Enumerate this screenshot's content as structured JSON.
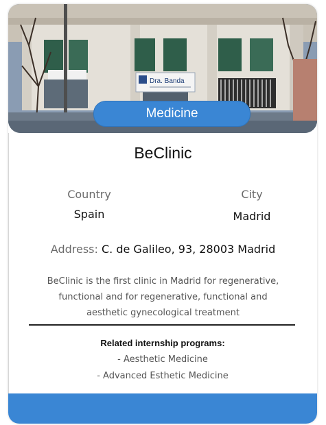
{
  "card": {
    "category": "Medicine",
    "name": "BeClinic",
    "country_label": "Country",
    "country_value": "Spain",
    "city_label": "City",
    "city_value": "Madrid",
    "address_label": "Address:",
    "address_value": "C. de Galileo, 93, 28003 Madrid",
    "description": "BeClinic is the first clinic in Madrid for regenerative, functional and for regenerative, functional and aesthetic gynecological treatment",
    "related_title": "Related internship programs:",
    "related_programs": [
      "- Aesthetic Medicine",
      "- Advanced Esthetic Medicine"
    ],
    "storefront_sign": "Dra. Banda"
  },
  "colors": {
    "accent": "#3a86d4",
    "text_primary": "#111111",
    "text_secondary": "#6b6b6b"
  }
}
